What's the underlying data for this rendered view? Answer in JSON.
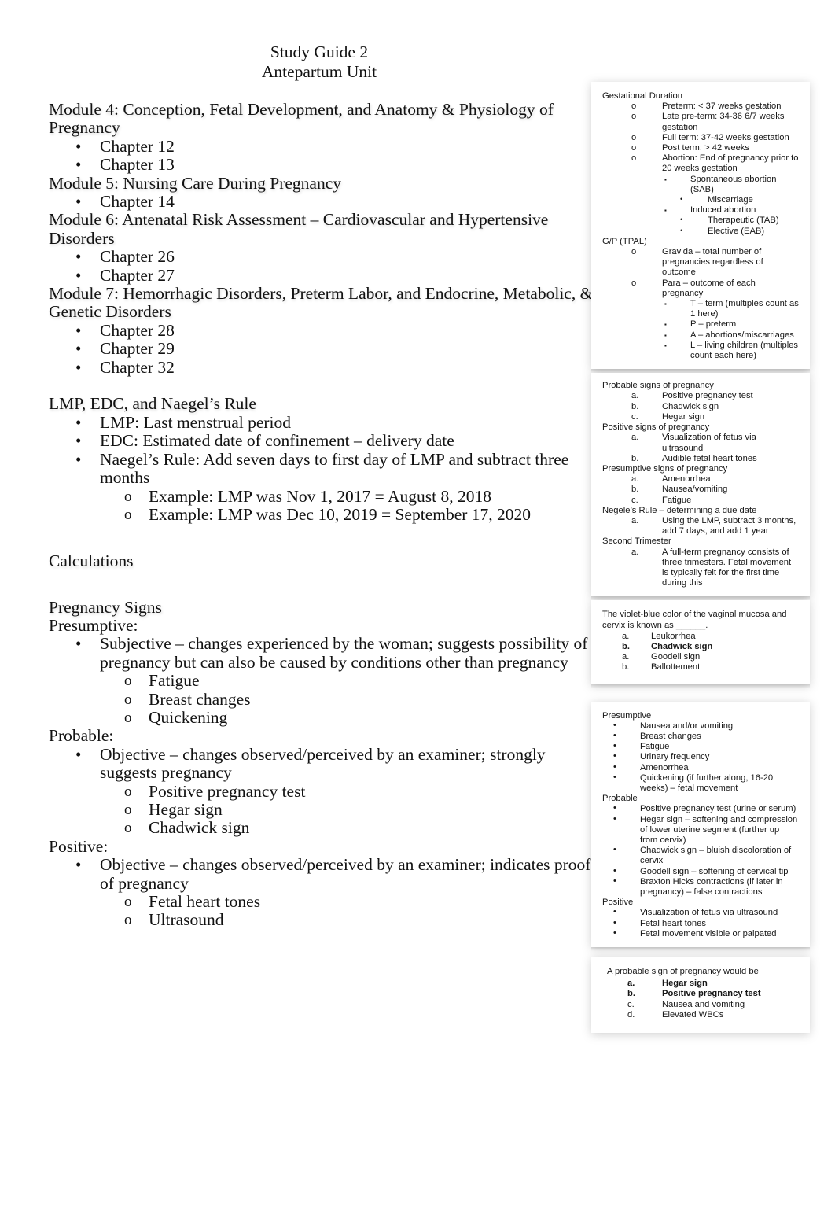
{
  "document": {
    "title_lines": [
      "Study Guide 2",
      "Antepartum Unit"
    ],
    "modules": [
      {
        "heading": "Module 4: Conception, Fetal Development, and Anatomy & Physiology of Pregnancy",
        "chapters": [
          "Chapter 12",
          "Chapter 13"
        ]
      },
      {
        "heading": "Module 5: Nursing Care During Pregnancy",
        "chapters": [
          "Chapter 14"
        ]
      },
      {
        "heading": "Module 6: Antenatal Risk Assessment – Cardiovascular and Hypertensive Disorders",
        "chapters": [
          "Chapter 26",
          "Chapter 27"
        ]
      },
      {
        "heading": "Module 7: Hemorrhagic Disorders, Preterm Labor, and Endocrine, Metabolic, & Genetic Disorders",
        "chapters": [
          "Chapter 28",
          "Chapter 29",
          "Chapter 32"
        ]
      }
    ],
    "lmp_section": {
      "heading": "LMP, EDC, and Naegel’s Rule",
      "bullets": [
        "LMP: Last menstrual period",
        "EDC: Estimated date of confinement – delivery date",
        "Naegel’s Rule: Add seven days to first day of LMP and subtract three months"
      ],
      "examples": [
        "Example: LMP was Nov 1, 2017 = August 8, 2018",
        "Example: LMP was Dec 10, 2019 = September 17, 2020"
      ]
    },
    "calculations_heading": "Calculations",
    "pregnancy_signs": {
      "heading": "Pregnancy Signs",
      "groups": [
        {
          "label": "Presumptive:",
          "definition": "Subjective – changes experienced by the woman; suggests possibility of pregnancy but can also be caused by conditions other than pregnancy",
          "items": [
            "Fatigue",
            "Breast changes",
            "Quickening"
          ]
        },
        {
          "label": "Probable:",
          "definition": "Objective – changes observed/perceived by an examiner; strongly suggests pregnancy",
          "items": [
            "Positive pregnancy test",
            "Hegar sign",
            "Chadwick sign"
          ]
        },
        {
          "label": "Positive:",
          "definition": "Objective – changes observed/perceived by an examiner; indicates proof of pregnancy",
          "items": [
            "Fetal heart tones",
            "Ultrasound"
          ]
        }
      ]
    }
  },
  "sidebar": {
    "panel1": {
      "section1_heading": "Gestational Duration",
      "section1_items": [
        {
          "marker": "o",
          "text": "Preterm: < 37 weeks gestation"
        },
        {
          "marker": "o",
          "text": "Late pre-term: 34-36 6/7 weeks gestation"
        },
        {
          "marker": "o",
          "text": "Full term: 37-42 weeks gestation"
        },
        {
          "marker": "o",
          "text": "Post term: > 42 weeks"
        },
        {
          "marker": "o",
          "text": "Abortion: End of pregnancy prior to 20 weeks gestation"
        }
      ],
      "abortion_sub": [
        {
          "level": 2,
          "marker": "▪",
          "text": "Spontaneous abortion (SAB)"
        },
        {
          "level": 3,
          "marker": "•",
          "text": "Miscarriage"
        },
        {
          "level": 2,
          "marker": "▪",
          "text": "Induced abortion"
        },
        {
          "level": 3,
          "marker": "•",
          "text": "Therapeutic (TAB)"
        },
        {
          "level": 3,
          "marker": "•",
          "text": "Elective (EAB)"
        }
      ],
      "section2_heading": "G/P (TPAL)",
      "section2_items": [
        {
          "marker": "o",
          "text": "Gravida – total number of pregnancies regardless of outcome"
        },
        {
          "marker": "o",
          "text": "Para – outcome of each pregnancy"
        }
      ],
      "para_sub": [
        {
          "marker": "▪",
          "text": "T – term (multiples count as 1 here)"
        },
        {
          "marker": "▪",
          "text": "P – preterm"
        },
        {
          "marker": "▪",
          "text": "A – abortions/miscarriages"
        },
        {
          "marker": "▪",
          "text": "L – living children (multiples count each here)"
        }
      ]
    },
    "panel2": {
      "groups": [
        {
          "heading": "Probable signs of pregnancy",
          "items": [
            {
              "marker": "a.",
              "text": "Positive pregnancy test"
            },
            {
              "marker": "b.",
              "text": "Chadwick sign"
            },
            {
              "marker": "c.",
              "text": "Hegar sign"
            }
          ]
        },
        {
          "heading": "Positive signs of pregnancy",
          "items": [
            {
              "marker": "a.",
              "text": "Visualization of fetus via ultrasound"
            },
            {
              "marker": "b.",
              "text": "Audible fetal heart tones"
            }
          ]
        },
        {
          "heading": "Presumptive signs of pregnancy",
          "items": [
            {
              "marker": "a.",
              "text": "Amenorrhea"
            },
            {
              "marker": "b.",
              "text": "Nausea/vomiting"
            },
            {
              "marker": "c.",
              "text": "Fatigue"
            }
          ]
        },
        {
          "heading": "Negele’s Rule – determining a due date",
          "items": [
            {
              "marker": "a.",
              "text": "Using the LMP, subtract 3 months, add 7 days, and add 1 year"
            }
          ]
        },
        {
          "heading": "Second Trimester",
          "items": [
            {
              "marker": "a.",
              "text": "A full-term pregnancy consists of three trimesters. Fetal movement is typically felt for the first time during this"
            }
          ]
        }
      ]
    },
    "panel3": {
      "question": "The violet-blue color of the vaginal mucosa and cervix is known as ______.",
      "options": [
        {
          "marker": "a.",
          "text": "Leukorrhea",
          "bold": false
        },
        {
          "marker": "b.",
          "text": "Chadwick sign",
          "bold": true
        },
        {
          "marker": "a.",
          "text": "Goodell sign",
          "bold": false
        },
        {
          "marker": "b.",
          "text": "Ballottement",
          "bold": false
        }
      ]
    },
    "panel4": {
      "groups": [
        {
          "heading": "Presumptive",
          "items": [
            "Nausea and/or vomiting",
            "Breast changes",
            "Fatigue",
            "Urinary frequency",
            "Amenorrhea",
            "Quickening (if further along, 16-20 weeks) – fetal movement"
          ]
        },
        {
          "heading": "Probable",
          "items": [
            "Positive pregnancy test (urine or serum)",
            "Hegar sign – softening and compression of lower uterine segment (further up from cervix)",
            "Chadwick sign – bluish discoloration of cervix",
            "Goodell sign – softening of cervical tip",
            "Braxton Hicks contractions (if later in pregnancy) – false contractions"
          ]
        },
        {
          "heading": "Positive",
          "items": [
            "Visualization of fetus via ultrasound",
            "Fetal heart tones",
            "Fetal movement visible or palpated"
          ]
        }
      ]
    },
    "panel5": {
      "question": "A probable sign of pregnancy would be",
      "options": [
        {
          "marker": "a.",
          "text": "Hegar sign",
          "bold": true
        },
        {
          "marker": "b.",
          "text": "Positive pregnancy test",
          "bold": true
        },
        {
          "marker": "c.",
          "text": "Nausea and vomiting",
          "bold": false
        },
        {
          "marker": "d.",
          "text": "Elevated WBCs",
          "bold": false
        }
      ]
    }
  }
}
